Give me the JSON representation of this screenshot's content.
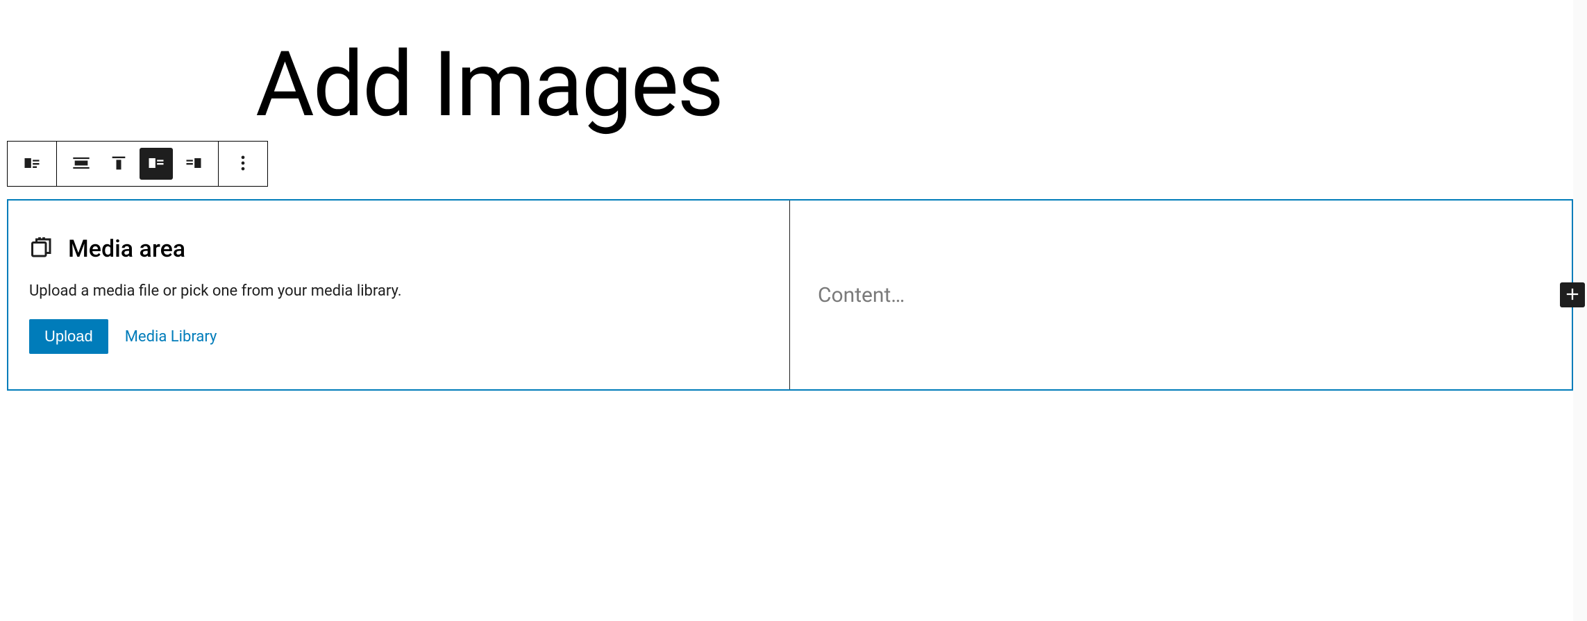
{
  "page": {
    "title": "Add Images"
  },
  "toolbar": {
    "icons": {
      "block_type": "media-text-icon",
      "align_wide": "align-wide-icon",
      "align_top": "align-top-icon",
      "media_left": "media-left-icon",
      "media_right": "media-right-icon",
      "more": "more-options-icon"
    }
  },
  "media_block": {
    "title": "Media area",
    "description": "Upload a media file or pick one from your media library.",
    "upload_label": "Upload",
    "library_label": "Media Library"
  },
  "content_block": {
    "placeholder": "Content…"
  },
  "colors": {
    "accent": "#007cba",
    "text_dark": "#1e1e1e",
    "text_muted": "#7a7a7a"
  }
}
